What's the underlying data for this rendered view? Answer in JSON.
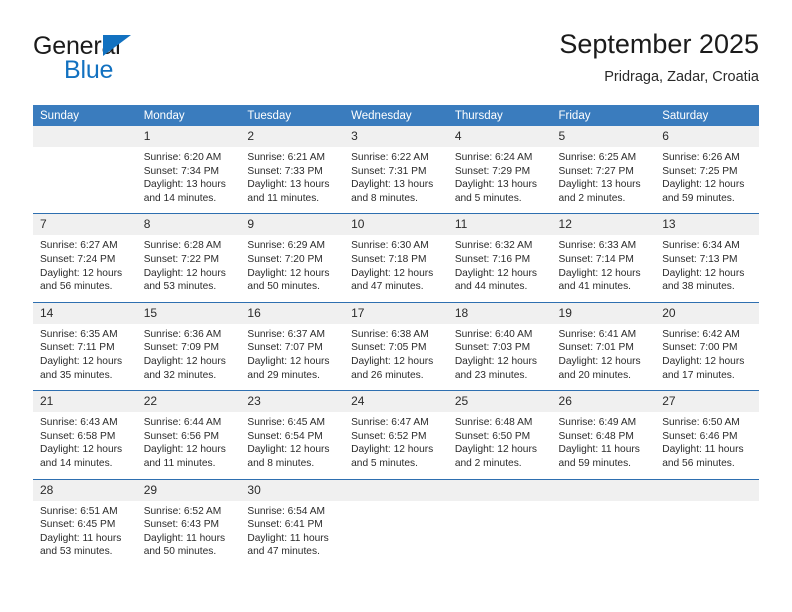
{
  "brand": {
    "name_part1": "General",
    "name_part2": "Blue",
    "flag_icon": "triangle-flag-icon",
    "accent_color": "#1271c0"
  },
  "header": {
    "title": "September 2025",
    "location": "Pridraga, Zadar, Croatia"
  },
  "colors": {
    "header_bar": "#3a7cbe",
    "row_divider": "#2e6fb0",
    "daynum_band": "#f0f0f0",
    "text": "#2b2b2b"
  },
  "calendar": {
    "weekday_headers": [
      "Sunday",
      "Monday",
      "Tuesday",
      "Wednesday",
      "Thursday",
      "Friday",
      "Saturday"
    ],
    "weeks": [
      [
        {
          "day": "",
          "sunrise": "",
          "sunset": "",
          "daylight_line1": "",
          "daylight_line2": "",
          "empty": true
        },
        {
          "day": "1",
          "sunrise": "Sunrise: 6:20 AM",
          "sunset": "Sunset: 7:34 PM",
          "daylight_line1": "Daylight: 13 hours",
          "daylight_line2": "and 14 minutes."
        },
        {
          "day": "2",
          "sunrise": "Sunrise: 6:21 AM",
          "sunset": "Sunset: 7:33 PM",
          "daylight_line1": "Daylight: 13 hours",
          "daylight_line2": "and 11 minutes."
        },
        {
          "day": "3",
          "sunrise": "Sunrise: 6:22 AM",
          "sunset": "Sunset: 7:31 PM",
          "daylight_line1": "Daylight: 13 hours",
          "daylight_line2": "and 8 minutes."
        },
        {
          "day": "4",
          "sunrise": "Sunrise: 6:24 AM",
          "sunset": "Sunset: 7:29 PM",
          "daylight_line1": "Daylight: 13 hours",
          "daylight_line2": "and 5 minutes."
        },
        {
          "day": "5",
          "sunrise": "Sunrise: 6:25 AM",
          "sunset": "Sunset: 7:27 PM",
          "daylight_line1": "Daylight: 13 hours",
          "daylight_line2": "and 2 minutes."
        },
        {
          "day": "6",
          "sunrise": "Sunrise: 6:26 AM",
          "sunset": "Sunset: 7:25 PM",
          "daylight_line1": "Daylight: 12 hours",
          "daylight_line2": "and 59 minutes."
        }
      ],
      [
        {
          "day": "7",
          "sunrise": "Sunrise: 6:27 AM",
          "sunset": "Sunset: 7:24 PM",
          "daylight_line1": "Daylight: 12 hours",
          "daylight_line2": "and 56 minutes."
        },
        {
          "day": "8",
          "sunrise": "Sunrise: 6:28 AM",
          "sunset": "Sunset: 7:22 PM",
          "daylight_line1": "Daylight: 12 hours",
          "daylight_line2": "and 53 minutes."
        },
        {
          "day": "9",
          "sunrise": "Sunrise: 6:29 AM",
          "sunset": "Sunset: 7:20 PM",
          "daylight_line1": "Daylight: 12 hours",
          "daylight_line2": "and 50 minutes."
        },
        {
          "day": "10",
          "sunrise": "Sunrise: 6:30 AM",
          "sunset": "Sunset: 7:18 PM",
          "daylight_line1": "Daylight: 12 hours",
          "daylight_line2": "and 47 minutes."
        },
        {
          "day": "11",
          "sunrise": "Sunrise: 6:32 AM",
          "sunset": "Sunset: 7:16 PM",
          "daylight_line1": "Daylight: 12 hours",
          "daylight_line2": "and 44 minutes."
        },
        {
          "day": "12",
          "sunrise": "Sunrise: 6:33 AM",
          "sunset": "Sunset: 7:14 PM",
          "daylight_line1": "Daylight: 12 hours",
          "daylight_line2": "and 41 minutes."
        },
        {
          "day": "13",
          "sunrise": "Sunrise: 6:34 AM",
          "sunset": "Sunset: 7:13 PM",
          "daylight_line1": "Daylight: 12 hours",
          "daylight_line2": "and 38 minutes."
        }
      ],
      [
        {
          "day": "14",
          "sunrise": "Sunrise: 6:35 AM",
          "sunset": "Sunset: 7:11 PM",
          "daylight_line1": "Daylight: 12 hours",
          "daylight_line2": "and 35 minutes."
        },
        {
          "day": "15",
          "sunrise": "Sunrise: 6:36 AM",
          "sunset": "Sunset: 7:09 PM",
          "daylight_line1": "Daylight: 12 hours",
          "daylight_line2": "and 32 minutes."
        },
        {
          "day": "16",
          "sunrise": "Sunrise: 6:37 AM",
          "sunset": "Sunset: 7:07 PM",
          "daylight_line1": "Daylight: 12 hours",
          "daylight_line2": "and 29 minutes."
        },
        {
          "day": "17",
          "sunrise": "Sunrise: 6:38 AM",
          "sunset": "Sunset: 7:05 PM",
          "daylight_line1": "Daylight: 12 hours",
          "daylight_line2": "and 26 minutes."
        },
        {
          "day": "18",
          "sunrise": "Sunrise: 6:40 AM",
          "sunset": "Sunset: 7:03 PM",
          "daylight_line1": "Daylight: 12 hours",
          "daylight_line2": "and 23 minutes."
        },
        {
          "day": "19",
          "sunrise": "Sunrise: 6:41 AM",
          "sunset": "Sunset: 7:01 PM",
          "daylight_line1": "Daylight: 12 hours",
          "daylight_line2": "and 20 minutes."
        },
        {
          "day": "20",
          "sunrise": "Sunrise: 6:42 AM",
          "sunset": "Sunset: 7:00 PM",
          "daylight_line1": "Daylight: 12 hours",
          "daylight_line2": "and 17 minutes."
        }
      ],
      [
        {
          "day": "21",
          "sunrise": "Sunrise: 6:43 AM",
          "sunset": "Sunset: 6:58 PM",
          "daylight_line1": "Daylight: 12 hours",
          "daylight_line2": "and 14 minutes."
        },
        {
          "day": "22",
          "sunrise": "Sunrise: 6:44 AM",
          "sunset": "Sunset: 6:56 PM",
          "daylight_line1": "Daylight: 12 hours",
          "daylight_line2": "and 11 minutes."
        },
        {
          "day": "23",
          "sunrise": "Sunrise: 6:45 AM",
          "sunset": "Sunset: 6:54 PM",
          "daylight_line1": "Daylight: 12 hours",
          "daylight_line2": "and 8 minutes."
        },
        {
          "day": "24",
          "sunrise": "Sunrise: 6:47 AM",
          "sunset": "Sunset: 6:52 PM",
          "daylight_line1": "Daylight: 12 hours",
          "daylight_line2": "and 5 minutes."
        },
        {
          "day": "25",
          "sunrise": "Sunrise: 6:48 AM",
          "sunset": "Sunset: 6:50 PM",
          "daylight_line1": "Daylight: 12 hours",
          "daylight_line2": "and 2 minutes."
        },
        {
          "day": "26",
          "sunrise": "Sunrise: 6:49 AM",
          "sunset": "Sunset: 6:48 PM",
          "daylight_line1": "Daylight: 11 hours",
          "daylight_line2": "and 59 minutes."
        },
        {
          "day": "27",
          "sunrise": "Sunrise: 6:50 AM",
          "sunset": "Sunset: 6:46 PM",
          "daylight_line1": "Daylight: 11 hours",
          "daylight_line2": "and 56 minutes."
        }
      ],
      [
        {
          "day": "28",
          "sunrise": "Sunrise: 6:51 AM",
          "sunset": "Sunset: 6:45 PM",
          "daylight_line1": "Daylight: 11 hours",
          "daylight_line2": "and 53 minutes."
        },
        {
          "day": "29",
          "sunrise": "Sunrise: 6:52 AM",
          "sunset": "Sunset: 6:43 PM",
          "daylight_line1": "Daylight: 11 hours",
          "daylight_line2": "and 50 minutes."
        },
        {
          "day": "30",
          "sunrise": "Sunrise: 6:54 AM",
          "sunset": "Sunset: 6:41 PM",
          "daylight_line1": "Daylight: 11 hours",
          "daylight_line2": "and 47 minutes."
        },
        {
          "day": "",
          "sunrise": "",
          "sunset": "",
          "daylight_line1": "",
          "daylight_line2": "",
          "empty": true
        },
        {
          "day": "",
          "sunrise": "",
          "sunset": "",
          "daylight_line1": "",
          "daylight_line2": "",
          "empty": true
        },
        {
          "day": "",
          "sunrise": "",
          "sunset": "",
          "daylight_line1": "",
          "daylight_line2": "",
          "empty": true
        },
        {
          "day": "",
          "sunrise": "",
          "sunset": "",
          "daylight_line1": "",
          "daylight_line2": "",
          "empty": true
        }
      ]
    ]
  }
}
